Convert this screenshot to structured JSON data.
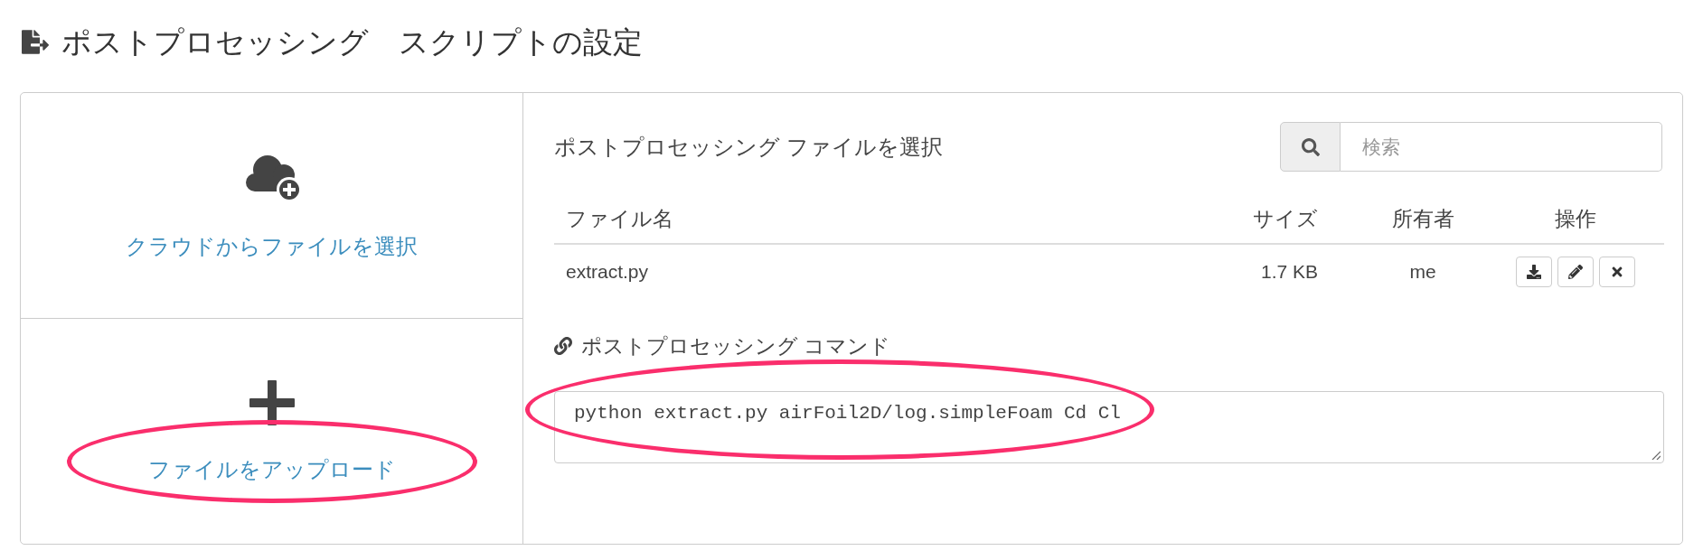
{
  "page_title": "ポストプロセッシング　スクリプトの設定",
  "sources": [
    {
      "kind": "cloud",
      "label": "クラウドからファイルを選択",
      "highlighted": false
    },
    {
      "kind": "upload",
      "label": "ファイルをアップロード",
      "highlighted": true
    }
  ],
  "file_picker": {
    "title": "ポストプロセッシング ファイルを選択",
    "search": {
      "placeholder": "検索"
    },
    "table": {
      "columns": [
        "ファイル名",
        "サイズ",
        "所有者",
        "操作"
      ],
      "rows": [
        {
          "name": "extract.py",
          "size": "1.7 KB",
          "owner": "me",
          "actions": [
            {
              "kind": "download"
            },
            {
              "kind": "edit"
            },
            {
              "kind": "delete"
            }
          ]
        }
      ]
    }
  },
  "command": {
    "label": "ポストプロセッシング コマンド",
    "value": "python extract.py airFoil2D/log.simpleFoam Cd Cl",
    "highlighted": true
  }
}
